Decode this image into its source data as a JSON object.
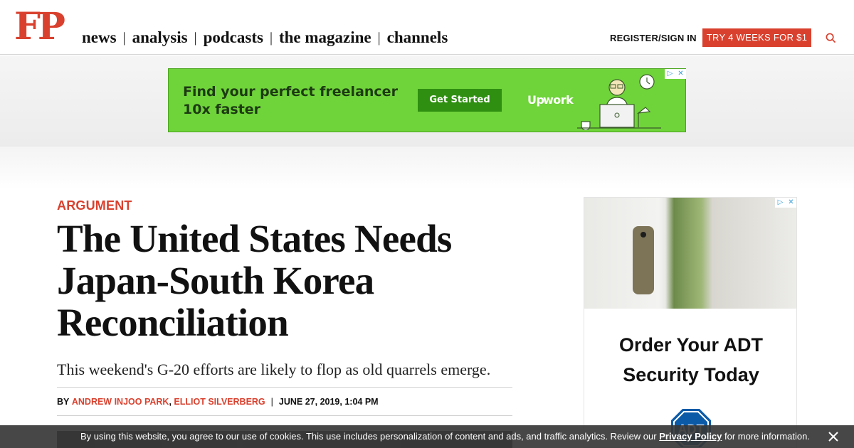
{
  "header": {
    "logo": "FP",
    "nav": [
      "news",
      "analysis",
      "podcasts",
      "the magazine",
      "channels"
    ],
    "register_label": "REGISTER/SIGN IN",
    "trial_label": "TRY 4 WEEKS FOR $1",
    "search_icon": "search-icon"
  },
  "top_ad": {
    "headline_line1": "Find your perfect freelancer",
    "headline_line2": "10x faster",
    "cta": "Get Started",
    "brand": "Upwork",
    "background": "#6fd33a"
  },
  "article": {
    "kicker": "ARGUMENT",
    "title_lines": [
      "The United States Needs",
      "Japan-South Korea",
      "Reconciliation"
    ],
    "dek": "This weekend's G-20 efforts are likely to flop as old quarrels emerge.",
    "byline_prefix": "BY",
    "authors": [
      "ANDREW INJOO PARK",
      "ELLIOT SILVERBERG"
    ],
    "date": "JUNE 27, 2019, 1:04 PM"
  },
  "side_ad": {
    "headline_line1": "Order Your ADT",
    "headline_line2": "Security Today",
    "logo_text": "ADT"
  },
  "cookie_bar": {
    "text_before": "By using this website, you agree to our use of cookies. This use includes personalization of content and ads, and traffic analytics. Review our",
    "link": "Privacy Policy",
    "text_after": "for more information."
  },
  "colors": {
    "brand_red": "#d9412e",
    "ad_green": "#6fd33a",
    "adt_blue": "#0a5aa8"
  }
}
